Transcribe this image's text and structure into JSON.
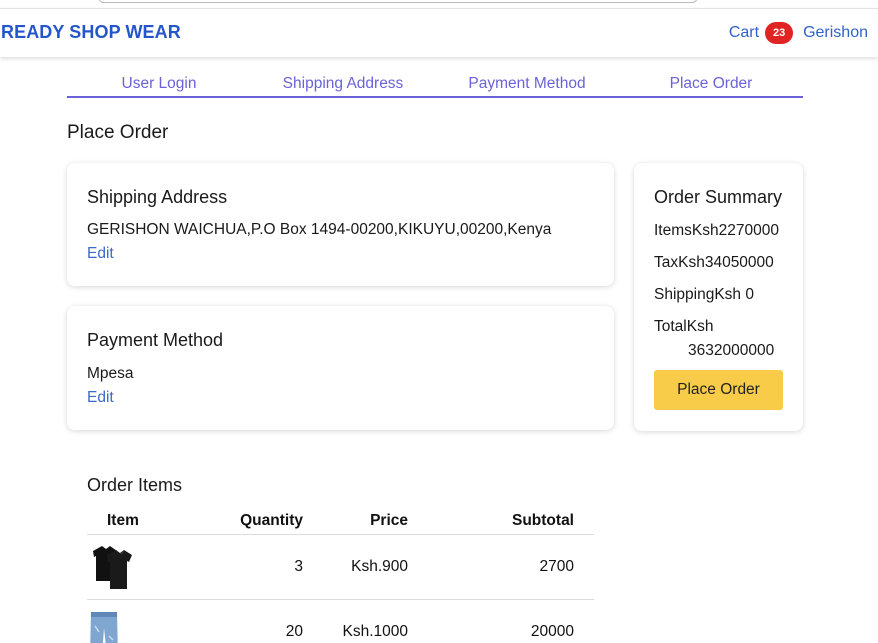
{
  "header": {
    "brand": "READY SHOP WEAR",
    "cart_label": "Cart",
    "cart_count": "23",
    "user_name": "Gerishon"
  },
  "steps": [
    "User Login",
    "Shipping Address",
    "Payment Method",
    "Place Order"
  ],
  "page_title": "Place Order",
  "shipping": {
    "title": "Shipping Address",
    "address": "GERISHON WAICHUA,P.O Box 1494-00200,KIKUYU,00200,Kenya",
    "edit_label": "Edit"
  },
  "payment": {
    "title": "Payment Method",
    "method": "Mpesa",
    "edit_label": "Edit"
  },
  "summary": {
    "title": "Order Summary",
    "items": "ItemsKsh2270000",
    "tax": "TaxKsh34050000",
    "shipping": "ShippingKsh 0",
    "total_label": "TotalKsh",
    "total_value": "3632000000",
    "button_label": "Place Order"
  },
  "order_items": {
    "title": "Order Items",
    "columns": [
      "Item",
      "Quantity",
      "Price",
      "Subtotal"
    ],
    "rows": [
      {
        "image": "black-tshirt",
        "quantity": "3",
        "price": "Ksh.900",
        "subtotal": "2700"
      },
      {
        "image": "blue-jeans",
        "quantity": "20",
        "price": "Ksh.1000",
        "subtotal": "20000"
      }
    ]
  },
  "colors": {
    "brand": "#2456c9",
    "steps": "#6a62d9",
    "cart_badge": "#e02424",
    "button": "#f8cc49",
    "link": "#3c6ac9"
  }
}
